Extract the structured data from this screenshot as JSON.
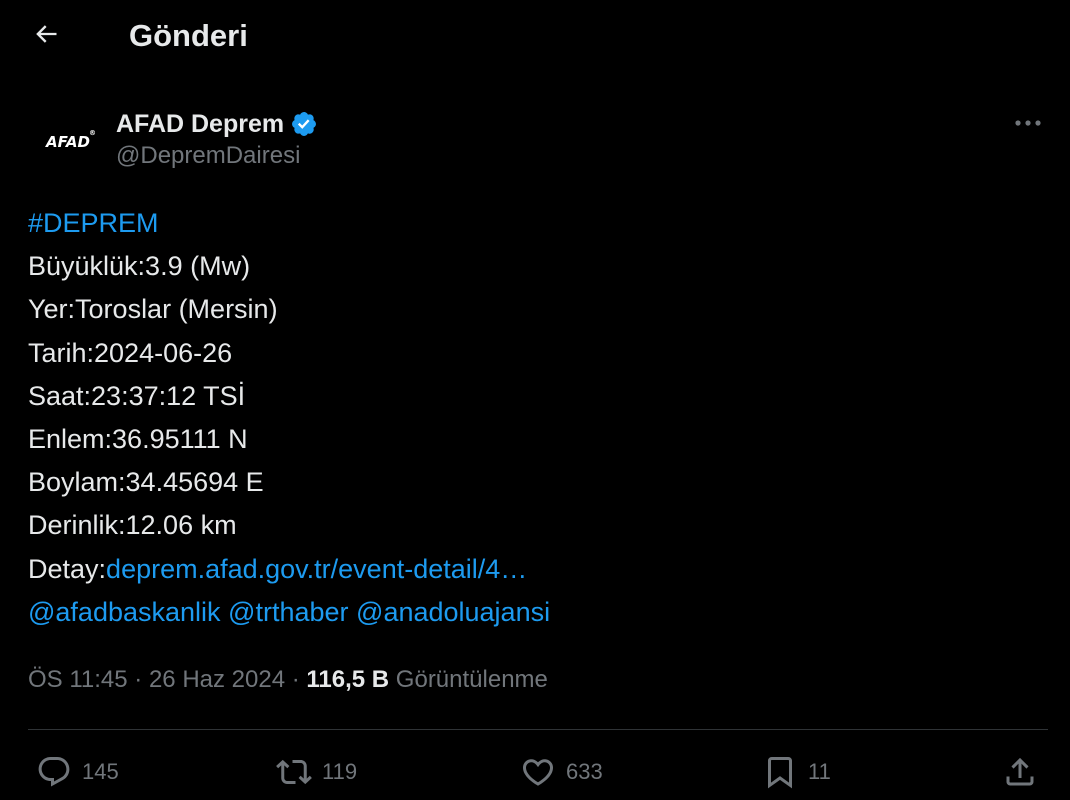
{
  "header": {
    "back_icon": "arrow-left-icon",
    "title": "Gönderi"
  },
  "author": {
    "avatar_text": "AFAD",
    "avatar_mark": "®",
    "display_name": "AFAD Deprem",
    "verified_icon": "verified-badge-icon",
    "handle": "@DepremDairesi",
    "more_icon": "more-horizontal-icon"
  },
  "tweet": {
    "hashtag": "#DEPREM",
    "lines": [
      "Büyüklük:3.9 (Mw)",
      "Yer:Toroslar (Mersin)",
      "Tarih:2024-06-26",
      "Saat:23:37:12 TSİ",
      "Enlem:36.95111 N",
      "Boylam:34.45694 E",
      "Derinlik:12.06 km"
    ],
    "detail_label": "Detay:",
    "detail_link": "deprem.afad.gov.tr/event-detail/4…",
    "mentions": [
      "@afadbaskanlik",
      "@trthaber",
      "@anadoluajansi"
    ]
  },
  "meta": {
    "time": "ÖS 11:45",
    "separator": " · ",
    "date": "26 Haz 2024",
    "views_count": "116,5 B",
    "views_label": "Görüntülenme"
  },
  "actions": {
    "reply": {
      "icon": "reply-icon",
      "count": "145"
    },
    "repost": {
      "icon": "repost-icon",
      "count": "119"
    },
    "like": {
      "icon": "heart-icon",
      "count": "633"
    },
    "bookmark": {
      "icon": "bookmark-icon",
      "count": "11"
    },
    "share": {
      "icon": "share-icon"
    }
  },
  "colors": {
    "background": "#000000",
    "text": "#e7e9ea",
    "muted": "#71767b",
    "link": "#1d9bf0",
    "verified": "#1d9bf0",
    "divider": "#2f3336"
  }
}
